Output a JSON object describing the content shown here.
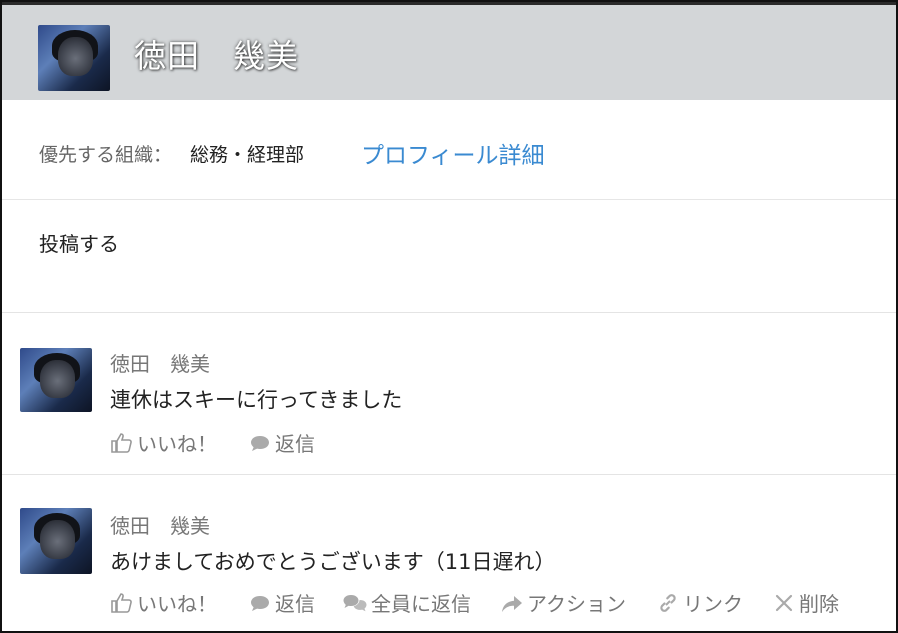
{
  "profile": {
    "name": "徳田　幾美",
    "org_label": "優先する組織：",
    "org_value": "総務・経理部",
    "profile_link": "プロフィール詳細"
  },
  "composer": {
    "prompt": "投稿する"
  },
  "feed": [
    {
      "author": "徳田　幾美",
      "message": "連休はスキーに行ってきました",
      "actions": {
        "like": "いいね！",
        "reply": "返信"
      }
    },
    {
      "author": "徳田　幾美",
      "message": "あけましておめでとうございます（11日遅れ）",
      "actions": {
        "like": "いいね！",
        "reply": "返信",
        "reply_all": "全員に返信",
        "action": "アクション",
        "link": "リンク",
        "delete": "削除"
      }
    }
  ],
  "colors": {
    "header_bg": "#d3d6d8",
    "link": "#3a8ad1",
    "muted": "#777777"
  },
  "icons": [
    "thumbs-up-icon",
    "speech-bubble-icon",
    "speech-bubbles-icon",
    "share-arrow-icon",
    "chain-link-icon",
    "close-x-icon"
  ]
}
